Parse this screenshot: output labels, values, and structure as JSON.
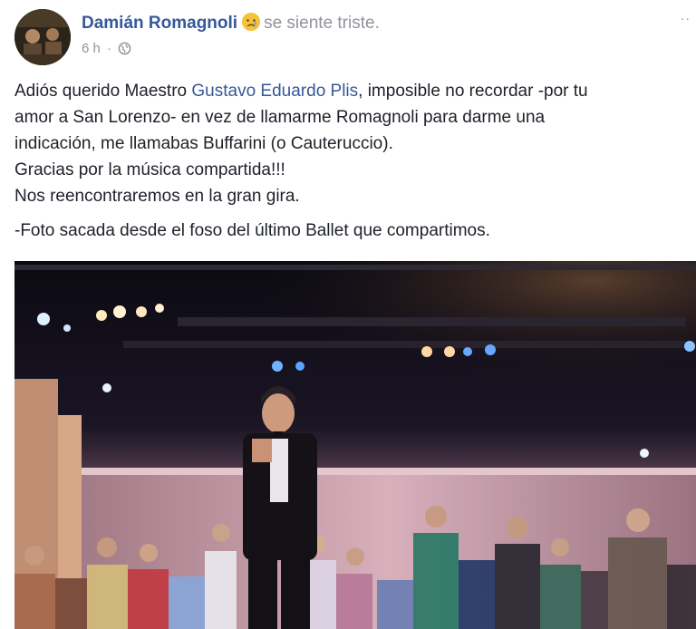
{
  "post": {
    "author": "Damián Romagnoli",
    "feeling": "se siente triste.",
    "feeling_icon": "sad-face-icon",
    "timestamp": "6 h",
    "separator": "·",
    "privacy_icon": "globe-icon",
    "more_label": "··"
  },
  "body": {
    "line1_pre": "Adiós querido Maestro ",
    "mention": "Gustavo Eduardo Plis",
    "line1_post": ", imposible no recordar -por tu",
    "line2": "amor a San Lorenzo- en vez de llamarme Romagnoli para darme una",
    "line3": "indicación, me llamabas Buffarini (o Cauteruccio).",
    "line4": "Gracias por la música compartida!!!",
    "line5": "Nos reencontraremos en la gran gira.",
    "caption": "-Foto sacada desde el foso del último Ballet que compartimos."
  },
  "colors": {
    "link": "#365899",
    "text": "#1d2129",
    "meta": "#90949c"
  },
  "photo": {
    "subject": "stage-curtain-call-photo"
  }
}
